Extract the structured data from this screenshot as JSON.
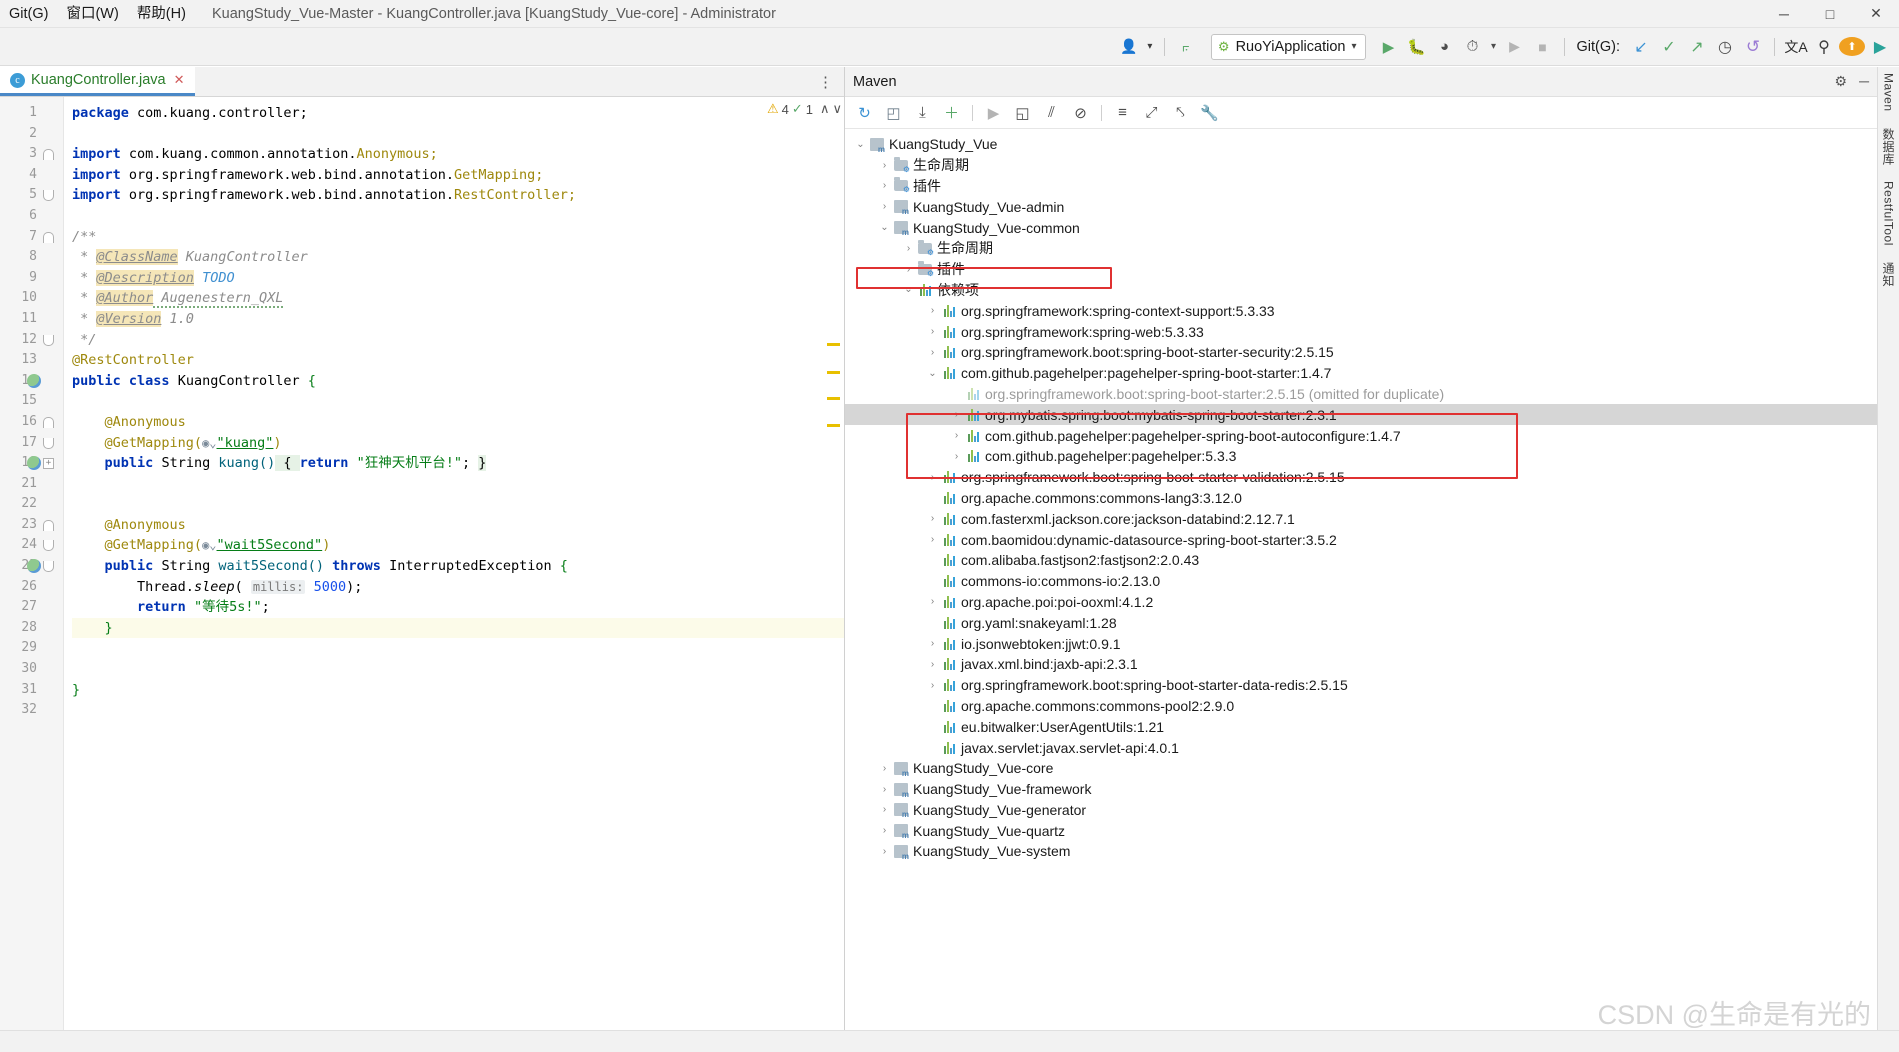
{
  "window": {
    "title": "KuangStudy_Vue-Master - KuangController.java [KuangStudy_Vue-core] - Administrator",
    "menus": [
      {
        "label": "Git(G)",
        "mnemonic": "G"
      },
      {
        "label": "窗口(W)",
        "mnemonic": "W"
      },
      {
        "label": "帮助(H)",
        "mnemonic": "H"
      }
    ],
    "controls": {
      "minimize": "─",
      "maximize": "□",
      "close": "✕"
    }
  },
  "toolbar": {
    "avatar_icon": "user-icon",
    "avatar_caret": "▾",
    "back_icon": "↖",
    "run_config": {
      "label": "RuoYiApplication",
      "icon": "spring-boot-icon",
      "caret": "▾"
    },
    "run_icon": "▶",
    "debug_icon": "debug-bug-icon",
    "coverage_icon": "run-with-coverage-icon",
    "profiler_icon": "profiler-icon",
    "profiler_caret": "▾",
    "rerun_icon": "▶",
    "stop_icon": "■",
    "git_label": "Git(G):",
    "git_update_icon": "↙",
    "git_commit_icon": "✓",
    "git_push_icon": "↗",
    "git_history_icon": "◷",
    "git_rollback_icon": "↺",
    "translate_icon": "文A",
    "search_icon": "⚲",
    "update_icon": "⬆",
    "ide_icon": "ide-logo-icon"
  },
  "editor": {
    "tab": {
      "label": "KuangController.java",
      "file_icon": "c",
      "close_icon": "✕"
    },
    "more_icon": "⋮",
    "inspections": {
      "warning_count": "4",
      "warning_icon": "⚠",
      "check_count": "1",
      "check_icon": "check-icon",
      "up_icon": "∧",
      "down_icon": "∨"
    },
    "lines": [
      {
        "n": "1",
        "code": "package com.kuang.controller;"
      },
      {
        "n": "2",
        "code": ""
      },
      {
        "n": "3",
        "code": "import com.kuang.common.annotation.Anonymous;"
      },
      {
        "n": "4",
        "code": "import org.springframework.web.bind.annotation.GetMapping;"
      },
      {
        "n": "5",
        "code": "import org.springframework.web.bind.annotation.RestController;"
      },
      {
        "n": "6",
        "code": ""
      },
      {
        "n": "7",
        "code": "/**"
      },
      {
        "n": "8",
        "code": " * @ClassName KuangController"
      },
      {
        "n": "9",
        "code": " * @Description TODO"
      },
      {
        "n": "10",
        "code": " * @Author Augenestern_QXL"
      },
      {
        "n": "11",
        "code": " * @Version 1.0"
      },
      {
        "n": "12",
        "code": " */"
      },
      {
        "n": "13",
        "code": "@RestController"
      },
      {
        "n": "14",
        "code": "public class KuangController {"
      },
      {
        "n": "15",
        "code": ""
      },
      {
        "n": "16",
        "code": "    @Anonymous"
      },
      {
        "n": "17",
        "code": "    @GetMapping(\"kuang\")"
      },
      {
        "n": "18",
        "code": "    public String kuang() { return \"狂神天机平台!\"; }"
      },
      {
        "n": "21",
        "code": ""
      },
      {
        "n": "22",
        "code": ""
      },
      {
        "n": "23",
        "code": "    @Anonymous"
      },
      {
        "n": "24",
        "code": "    @GetMapping(\"wait5Second\")"
      },
      {
        "n": "25",
        "code": "    public String wait5Second() throws InterruptedException {"
      },
      {
        "n": "26",
        "code": "        Thread.sleep( millis: 5000);"
      },
      {
        "n": "27",
        "code": "        return \"等待5s!\";"
      },
      {
        "n": "28",
        "code": "    }"
      },
      {
        "n": "29",
        "code": ""
      },
      {
        "n": "30",
        "code": ""
      },
      {
        "n": "31",
        "code": "}"
      },
      {
        "n": "32",
        "code": ""
      }
    ],
    "tokens": {
      "package": "package",
      "import": "import",
      "public": "public",
      "class": "class",
      "return": "return",
      "throws": "throws",
      "string_type": "String",
      "pkg_name": "com.kuang.controller;",
      "import1_path": "com.kuang.common.annotation.",
      "import1_type": "Anonymous;",
      "import2_path": "org.springframework.web.bind.annotation.",
      "import2_type": "GetMapping;",
      "import3_path": "org.springframework.web.bind.annotation.",
      "import3_type": "RestController;",
      "doc_open": "/**",
      "doc_close": " */",
      "star": " * ",
      "tag_classname": "@ClassName",
      "val_classname": " KuangController",
      "tag_description": "@Description",
      "val_description": " TODO",
      "tag_author": "@Author",
      "val_author": " Augenestern_QXL",
      "tag_version": "@Version",
      "val_version": " 1.0",
      "ann_restcontroller": "@RestController",
      "class_name": "KuangController",
      "brace_open": "{",
      "brace_close": "}",
      "ann_anonymous": "@Anonymous",
      "ann_getmapping": "@GetMapping(",
      "web_icon": "◉⌄",
      "map1": "\"kuang\"",
      "map2": "\"wait5Second\"",
      "paren_close": ")",
      "m1_name": "kuang()",
      "m1_body_open": " { ",
      "m1_str": "\"狂神天机平台!\"",
      "m1_semi": "; ",
      "m1_body_close": "}",
      "m2_name": "wait5Second()",
      "exception": "InterruptedException",
      "thread": "Thread.",
      "sleep": "sleep",
      "hint_millis": "millis:",
      "num_5000": "5000",
      "semi_paren": ");",
      "ret_str": "\"等待5s!\"",
      "semi": ";"
    }
  },
  "maven": {
    "title": "Maven",
    "header_icons": {
      "settings": "⚙",
      "hide": "─"
    },
    "toolbar_icons": [
      {
        "name": "reload-all-maven-projects-icon",
        "glyph": "↻"
      },
      {
        "name": "generate-sources-icon",
        "glyph": "◰"
      },
      {
        "name": "download-sources-icon",
        "glyph": "⤓"
      },
      {
        "name": "add-maven-project-icon",
        "glyph": "＋"
      },
      {
        "name": "run-icon",
        "glyph": "▶"
      },
      {
        "name": "execute-maven-goal-icon",
        "glyph": "◱"
      },
      {
        "name": "toggle-skip-tests-icon",
        "glyph": "⫽"
      },
      {
        "name": "toggle-offline-icon",
        "glyph": "⊘"
      },
      {
        "name": "show-dependencies-icon",
        "glyph": "≡"
      },
      {
        "name": "collapse-all-icon",
        "glyph": "⤢"
      },
      {
        "name": "expand-all-icon",
        "glyph": "⤣"
      },
      {
        "name": "maven-settings-icon",
        "glyph": "🔧"
      }
    ],
    "tree": [
      {
        "depth": 0,
        "arrow": "⌄",
        "icon": "module",
        "label": "KuangStudy_Vue"
      },
      {
        "depth": 1,
        "arrow": "›",
        "icon": "folder",
        "label": "生命周期"
      },
      {
        "depth": 1,
        "arrow": "›",
        "icon": "folder",
        "label": "插件"
      },
      {
        "depth": 1,
        "arrow": "›",
        "icon": "module",
        "label": "KuangStudy_Vue-admin"
      },
      {
        "depth": 1,
        "arrow": "⌄",
        "icon": "module",
        "label": "KuangStudy_Vue-common"
      },
      {
        "depth": 2,
        "arrow": "›",
        "icon": "folder",
        "label": "生命周期"
      },
      {
        "depth": 2,
        "arrow": "›",
        "icon": "folder",
        "label": "插件"
      },
      {
        "depth": 2,
        "arrow": "⌄",
        "icon": "bars",
        "label": "依赖项"
      },
      {
        "depth": 3,
        "arrow": "›",
        "icon": "bars",
        "label": "org.springframework:spring-context-support:5.3.33"
      },
      {
        "depth": 3,
        "arrow": "›",
        "icon": "bars",
        "label": "org.springframework:spring-web:5.3.33"
      },
      {
        "depth": 3,
        "arrow": "›",
        "icon": "bars",
        "label": "org.springframework.boot:spring-boot-starter-security:2.5.15"
      },
      {
        "depth": 3,
        "arrow": "⌄",
        "icon": "bars",
        "label": "com.github.pagehelper:pagehelper-spring-boot-starter:1.4.7"
      },
      {
        "depth": 4,
        "arrow": "",
        "icon": "bars",
        "label": "org.springframework.boot:spring-boot-starter:2.5.15 (omitted for duplicate)",
        "dim": true
      },
      {
        "depth": 4,
        "arrow": "›",
        "icon": "bars",
        "label": "org.mybatis.spring.boot:mybatis-spring-boot-starter:2.3.1",
        "selected": true
      },
      {
        "depth": 4,
        "arrow": "›",
        "icon": "bars",
        "label": "com.github.pagehelper:pagehelper-spring-boot-autoconfigure:1.4.7"
      },
      {
        "depth": 4,
        "arrow": "›",
        "icon": "bars",
        "label": "com.github.pagehelper:pagehelper:5.3.3"
      },
      {
        "depth": 3,
        "arrow": "›",
        "icon": "bars",
        "label": "org.springframework.boot:spring-boot-starter-validation:2.5.15"
      },
      {
        "depth": 3,
        "arrow": "",
        "icon": "bars",
        "label": "org.apache.commons:commons-lang3:3.12.0"
      },
      {
        "depth": 3,
        "arrow": "›",
        "icon": "bars",
        "label": "com.fasterxml.jackson.core:jackson-databind:2.12.7.1"
      },
      {
        "depth": 3,
        "arrow": "›",
        "icon": "bars",
        "label": "com.baomidou:dynamic-datasource-spring-boot-starter:3.5.2"
      },
      {
        "depth": 3,
        "arrow": "",
        "icon": "bars",
        "label": "com.alibaba.fastjson2:fastjson2:2.0.43"
      },
      {
        "depth": 3,
        "arrow": "",
        "icon": "bars",
        "label": "commons-io:commons-io:2.13.0"
      },
      {
        "depth": 3,
        "arrow": "›",
        "icon": "bars",
        "label": "org.apache.poi:poi-ooxml:4.1.2"
      },
      {
        "depth": 3,
        "arrow": "",
        "icon": "bars",
        "label": "org.yaml:snakeyaml:1.28"
      },
      {
        "depth": 3,
        "arrow": "›",
        "icon": "bars",
        "label": "io.jsonwebtoken:jjwt:0.9.1"
      },
      {
        "depth": 3,
        "arrow": "›",
        "icon": "bars",
        "label": "javax.xml.bind:jaxb-api:2.3.1"
      },
      {
        "depth": 3,
        "arrow": "›",
        "icon": "bars",
        "label": "org.springframework.boot:spring-boot-starter-data-redis:2.5.15"
      },
      {
        "depth": 3,
        "arrow": "",
        "icon": "bars",
        "label": "org.apache.commons:commons-pool2:2.9.0"
      },
      {
        "depth": 3,
        "arrow": "",
        "icon": "bars",
        "label": "eu.bitwalker:UserAgentUtils:1.21"
      },
      {
        "depth": 3,
        "arrow": "",
        "icon": "bars",
        "label": "javax.servlet:javax.servlet-api:4.0.1"
      },
      {
        "depth": 1,
        "arrow": "›",
        "icon": "module",
        "label": "KuangStudy_Vue-core"
      },
      {
        "depth": 1,
        "arrow": "›",
        "icon": "module",
        "label": "KuangStudy_Vue-framework"
      },
      {
        "depth": 1,
        "arrow": "›",
        "icon": "module",
        "label": "KuangStudy_Vue-generator"
      },
      {
        "depth": 1,
        "arrow": "›",
        "icon": "module",
        "label": "KuangStudy_Vue-quartz"
      },
      {
        "depth": 1,
        "arrow": "›",
        "icon": "module",
        "label": "KuangStudy_Vue-system"
      }
    ]
  },
  "right_strip": {
    "items": [
      {
        "label": "Maven",
        "name": "tool-window-maven"
      },
      {
        "label": "数据库",
        "name": "tool-window-database"
      },
      {
        "label": "RestfulTool",
        "name": "tool-window-restfultool"
      },
      {
        "label": "通知",
        "name": "tool-window-notifications"
      }
    ]
  },
  "watermark": "CSDN @生命是有光的",
  "colors": {
    "accent_blue": "#4a88c7",
    "highlight_red": "#e03131",
    "selection_gray": "#d6d6d6",
    "keyword_blue": "#0033b3",
    "annotation_gold": "#9e880d",
    "string_green": "#067d17",
    "current_line": "#fcfbe9"
  }
}
